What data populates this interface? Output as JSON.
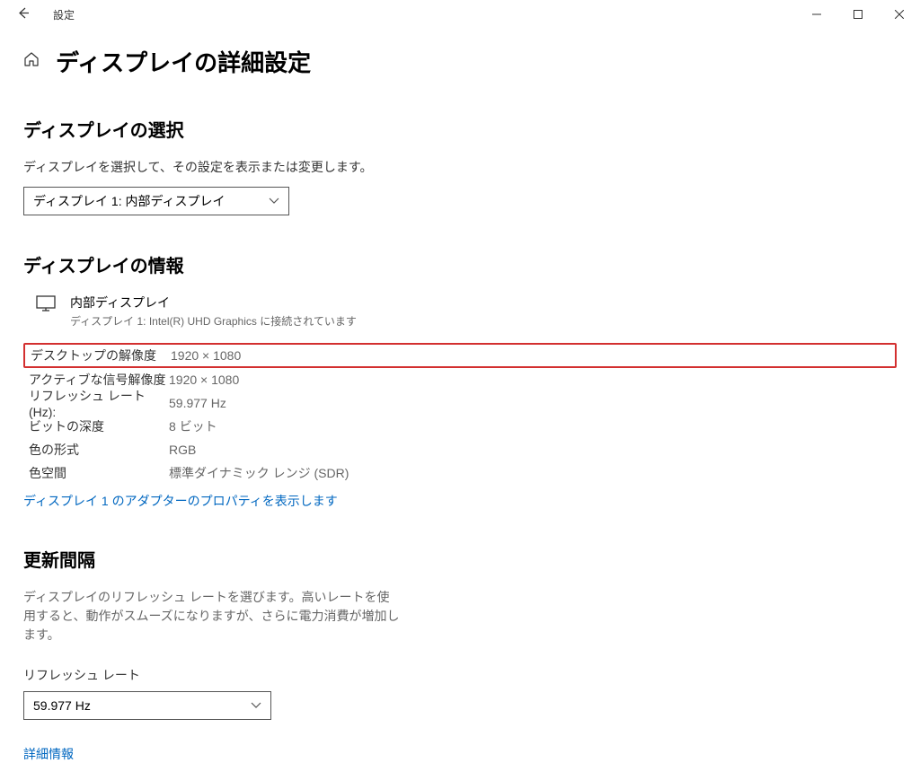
{
  "window": {
    "title": "設定"
  },
  "page": {
    "title": "ディスプレイの詳細設定"
  },
  "select_display": {
    "heading": "ディスプレイの選択",
    "description": "ディスプレイを選択して、その設定を表示または変更します。",
    "selected": "ディスプレイ 1: 内部ディスプレイ"
  },
  "display_info": {
    "heading": "ディスプレイの情報",
    "name": "内部ディスプレイ",
    "connection": "ディスプレイ 1: Intel(R) UHD Graphics に接続されています",
    "rows": {
      "desktop_res_label": "デスクトップの解像度",
      "desktop_res_value": "1920 × 1080",
      "active_res_label": "アクティブな信号解像度",
      "active_res_value": "1920 × 1080",
      "refresh_label": "リフレッシュ レート (Hz):",
      "refresh_value": "59.977 Hz",
      "bit_depth_label": "ビットの深度",
      "bit_depth_value": "8 ビット",
      "color_format_label": "色の形式",
      "color_format_value": "RGB",
      "color_space_label": "色空間",
      "color_space_value": "標準ダイナミック レンジ (SDR)"
    },
    "adapter_link": "ディスプレイ 1 のアダプターのプロパティを表示します"
  },
  "refresh_section": {
    "heading": "更新間隔",
    "description": "ディスプレイのリフレッシュ レートを選びます。高いレートを使用すると、動作がスムーズになりますが、さらに電力消費が増加します。",
    "field_label": "リフレッシュ レート",
    "selected": "59.977 Hz",
    "details_link": "詳細情報"
  }
}
